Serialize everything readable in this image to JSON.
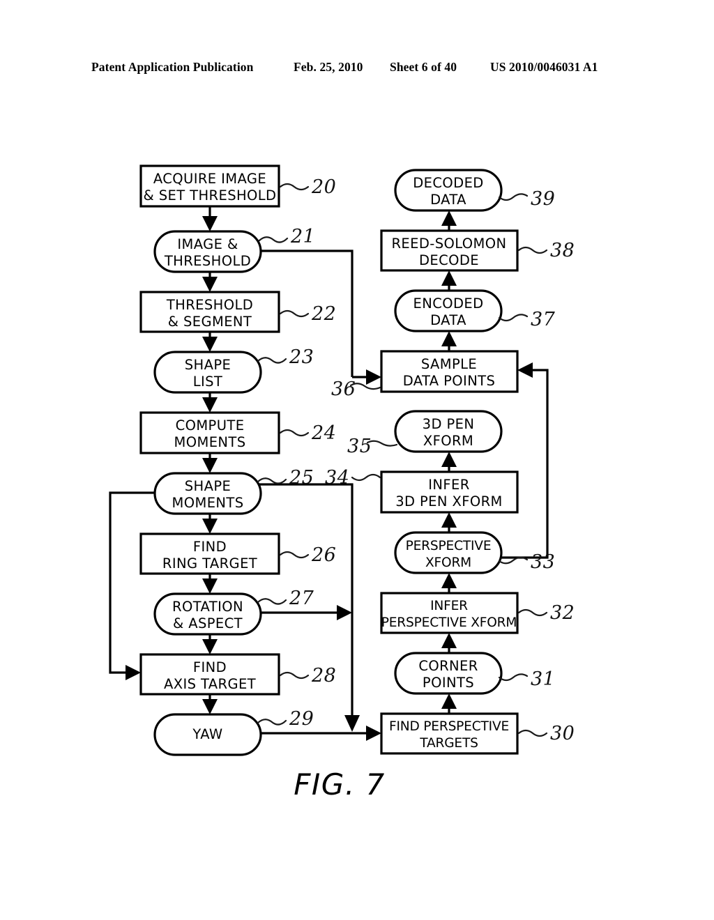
{
  "header": {
    "publication": "Patent Application Publication",
    "date": "Feb. 25, 2010",
    "sheet": "Sheet 6 of 40",
    "patent_number": "US 2010/0046031 A1"
  },
  "figure": {
    "caption": "FIG. 7",
    "colors": {
      "ink": "#000000",
      "background": "#ffffff"
    }
  },
  "chart_data": {
    "type": "diagram",
    "title": "FIG. 7",
    "diagram_kind": "flowchart",
    "columns": [
      {
        "name": "left-processing-column",
        "flow_direction": "top-to-bottom"
      },
      {
        "name": "right-decoding-column",
        "flow_direction": "bottom-to-top"
      }
    ],
    "nodes": [
      {
        "ref": "20",
        "label": "ACQUIRE IMAGE\n& SET THRESHOLD",
        "line1": "ACQUIRE IMAGE",
        "line2": "& SET THRESHOLD",
        "shape": "rectangle",
        "column": "left",
        "ref_side": "right"
      },
      {
        "ref": "21",
        "label": "IMAGE &\nTHRESHOLD",
        "line1": "IMAGE &",
        "line2": "THRESHOLD",
        "shape": "stadium",
        "column": "left",
        "ref_side": "right"
      },
      {
        "ref": "22",
        "label": "THRESHOLD\n& SEGMENT",
        "line1": "THRESHOLD",
        "line2": "& SEGMENT",
        "shape": "rectangle",
        "column": "left",
        "ref_side": "right"
      },
      {
        "ref": "23",
        "label": "SHAPE\nLIST",
        "line1": "SHAPE",
        "line2": "LIST",
        "shape": "stadium",
        "column": "left",
        "ref_side": "right"
      },
      {
        "ref": "24",
        "label": "COMPUTE\nMOMENTS",
        "line1": "COMPUTE",
        "line2": "MOMENTS",
        "shape": "rectangle",
        "column": "left",
        "ref_side": "right"
      },
      {
        "ref": "25",
        "label": "SHAPE\nMOMENTS",
        "line1": "SHAPE",
        "line2": "MOMENTS",
        "shape": "stadium",
        "column": "left",
        "ref_side": "right"
      },
      {
        "ref": "26",
        "label": "FIND\nRING TARGET",
        "line1": "FIND",
        "line2": "RING TARGET",
        "shape": "rectangle",
        "column": "left",
        "ref_side": "right"
      },
      {
        "ref": "27",
        "label": "ROTATION\n& ASPECT",
        "line1": "ROTATION",
        "line2": "& ASPECT",
        "shape": "stadium",
        "column": "left",
        "ref_side": "right"
      },
      {
        "ref": "28",
        "label": "FIND\nAXIS TARGET",
        "line1": "FIND",
        "line2": "AXIS TARGET",
        "shape": "rectangle",
        "column": "left",
        "ref_side": "right"
      },
      {
        "ref": "29",
        "label": "YAW",
        "line1": "YAW",
        "line2": "",
        "shape": "stadium",
        "column": "left",
        "ref_side": "right"
      },
      {
        "ref": "30",
        "label": "FIND PERSPECTIVE\nTARGETS",
        "line1": "FIND PERSPECTIVE",
        "line2": "TARGETS",
        "shape": "rectangle",
        "column": "right",
        "ref_side": "right"
      },
      {
        "ref": "31",
        "label": "CORNER\nPOINTS",
        "line1": "CORNER",
        "line2": "POINTS",
        "shape": "stadium",
        "column": "right",
        "ref_side": "right"
      },
      {
        "ref": "32",
        "label": "INFER\nPERSPECTIVE XFORM",
        "line1": "INFER",
        "line2": "PERSPECTIVE XFORM",
        "shape": "rectangle",
        "column": "right",
        "ref_side": "right"
      },
      {
        "ref": "33",
        "label": "PERSPECTIVE\nXFORM",
        "line1": "PERSPECTIVE",
        "line2": "XFORM",
        "shape": "stadium",
        "column": "right",
        "ref_side": "right"
      },
      {
        "ref": "34",
        "label": "INFER\n3D PEN XFORM",
        "line1": "INFER",
        "line2": "3D PEN XFORM",
        "shape": "rectangle",
        "column": "right",
        "ref_side": "left"
      },
      {
        "ref": "35",
        "label": "3D PEN\nXFORM",
        "line1": "3D PEN",
        "line2": "XFORM",
        "shape": "stadium",
        "column": "right",
        "ref_side": "left"
      },
      {
        "ref": "36",
        "label": "SAMPLE\nDATA POINTS",
        "line1": "SAMPLE",
        "line2": "DATA POINTS",
        "shape": "rectangle",
        "column": "right",
        "ref_side": "left"
      },
      {
        "ref": "37",
        "label": "ENCODED\nDATA",
        "line1": "ENCODED",
        "line2": "DATA",
        "shape": "stadium",
        "column": "right",
        "ref_side": "right"
      },
      {
        "ref": "38",
        "label": "REED-SOLOMON\nDECODE",
        "line1": "REED-SOLOMON",
        "line2": "DECODE",
        "shape": "rectangle",
        "column": "right",
        "ref_side": "right"
      },
      {
        "ref": "39",
        "label": "DECODED\nDATA",
        "line1": "DECODED",
        "line2": "DATA",
        "shape": "stadium",
        "column": "right",
        "ref_side": "right"
      }
    ],
    "edges": [
      {
        "from": "20",
        "to": "21",
        "kind": "down-arrow"
      },
      {
        "from": "21",
        "to": "22",
        "kind": "down-arrow"
      },
      {
        "from": "22",
        "to": "23",
        "kind": "down-arrow"
      },
      {
        "from": "23",
        "to": "24",
        "kind": "down-arrow"
      },
      {
        "from": "24",
        "to": "25",
        "kind": "down-arrow"
      },
      {
        "from": "25",
        "to": "26",
        "kind": "down-arrow"
      },
      {
        "from": "26",
        "to": "27",
        "kind": "down-arrow"
      },
      {
        "from": "27",
        "to": "28",
        "kind": "down-arrow"
      },
      {
        "from": "28",
        "to": "29",
        "kind": "down-arrow"
      },
      {
        "from": "21",
        "to": "36",
        "kind": "right-then-down-arrow"
      },
      {
        "from": "25",
        "to": "28",
        "kind": "left-loop-down-arrow"
      },
      {
        "from": "25",
        "to": "30",
        "kind": "right-then-down-arrow"
      },
      {
        "from": "27",
        "to": "trunk",
        "kind": "right-arrow"
      },
      {
        "from": "29",
        "to": "30",
        "kind": "right-arrow"
      },
      {
        "from": "30",
        "to": "31",
        "kind": "up-arrow"
      },
      {
        "from": "31",
        "to": "32",
        "kind": "up-arrow"
      },
      {
        "from": "32",
        "to": "33",
        "kind": "up-arrow"
      },
      {
        "from": "33",
        "to": "34",
        "kind": "up-arrow"
      },
      {
        "from": "34",
        "to": "35",
        "kind": "up-arrow"
      },
      {
        "from": "33",
        "to": "36",
        "kind": "right-then-up-arrow"
      },
      {
        "from": "36",
        "to": "37",
        "kind": "up-arrow"
      },
      {
        "from": "37",
        "to": "38",
        "kind": "up-arrow"
      },
      {
        "from": "38",
        "to": "39",
        "kind": "up-arrow"
      }
    ]
  }
}
